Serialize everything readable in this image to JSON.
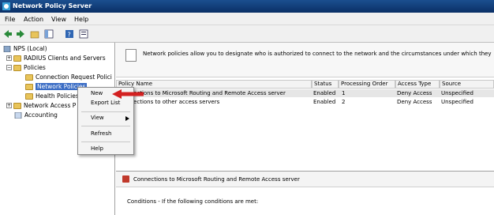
{
  "window": {
    "title": "Network Policy Server"
  },
  "menu": [
    "File",
    "Action",
    "View",
    "Help"
  ],
  "toolbar": [
    "back-icon",
    "forward-icon",
    "up-folder-icon",
    "show-tree-icon",
    "help-icon",
    "properties-icon"
  ],
  "tree": {
    "root": "NPS (Local)",
    "radius": "RADIUS Clients and Servers",
    "policies": "Policies",
    "connection_request": "Connection Request Polici",
    "network_policies": "Network Policies",
    "health_policies": "Health Policies",
    "network_access": "Network Access P",
    "accounting": "Accounting"
  },
  "banner": {
    "text": "Network policies allow you to designate who is authorized to connect to the network and the circumstances under which they"
  },
  "table": {
    "headers": [
      "Policy Name",
      "Status",
      "Processing Order",
      "Access Type",
      "Source"
    ],
    "rows": [
      [
        "Connections to Microsoft Routing and Remote Access server",
        "Enabled",
        "1",
        "Deny Access",
        "Unspecified"
      ],
      [
        "Connections to other access servers",
        "Enabled",
        "2",
        "Deny Access",
        "Unspecified"
      ]
    ]
  },
  "detail": {
    "title": "Connections to Microsoft Routing and Remote Access server",
    "conditions": "Conditions - If the following conditions are met:"
  },
  "context_menu": {
    "new": "New",
    "export": "Export List",
    "view": "View",
    "refresh": "Refresh",
    "help": "Help"
  },
  "colors": {
    "titlebar": "#0a2f66",
    "selection": "#3a6cc4",
    "arrow": "#d32020"
  }
}
